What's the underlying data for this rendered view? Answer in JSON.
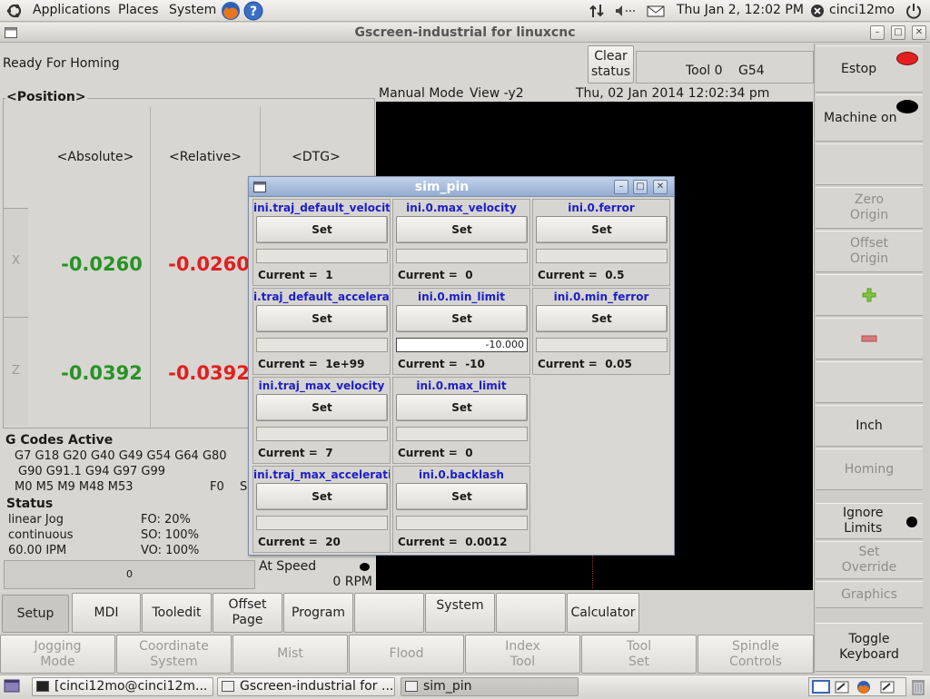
{
  "top_panel": {
    "menus": [
      "Applications",
      "Places",
      "System"
    ],
    "clock": "Thu Jan  2, 12:02 PM",
    "user": "cinci12mo"
  },
  "window": {
    "title": "Gscreen-industrial for linuxcnc"
  },
  "status_bar": {
    "message": "Ready For Homing",
    "clear_status": "Clear\nstatus",
    "tool": "Tool 0",
    "work_offset": "G54"
  },
  "position": {
    "header": "<Position>",
    "columns": [
      "<Absolute>",
      "<Relative>",
      "<DTG>"
    ],
    "axes": [
      {
        "label": "X",
        "absolute": "-0.0260",
        "relative": "-0.0260"
      },
      {
        "label": "Z",
        "absolute": "-0.0392",
        "relative": "-0.0392"
      }
    ]
  },
  "preview": {
    "mode": "Manual Mode",
    "view": "View -y2",
    "datetime": "Thu, 02 Jan 2014  12:02:34 pm"
  },
  "gcodes": {
    "header": "G Codes Active",
    "line1": "G7 G18 G20 G40 G49 G54 G64 G80",
    "line2": "G90 G91.1 G94 G97 G99",
    "line3": "M0 M5 M9 M48 M53",
    "feed": "F0",
    "spindle_partial": "S"
  },
  "status_panel": {
    "header": "Status",
    "jog": "linear Jog",
    "mode": "continuous",
    "rate": "60.00 IPM",
    "fo": "FO: 20%",
    "so": "SO: 100%",
    "vo": "VO: 100%",
    "jog_value": "0",
    "at_speed": "At Speed",
    "rpm": "0 RPM"
  },
  "right_buttons": {
    "estop": "Estop",
    "machine_on": "Machine on",
    "zero_origin": "Zero\nOrigin",
    "offset_origin": "Offset\nOrigin",
    "inch": "Inch",
    "homing": "Homing",
    "ignore_limits": "Ignore\nLimits",
    "set_override": "Set\nOverride",
    "graphics": "Graphics",
    "toggle_keyboard": "Toggle\nKeyboard"
  },
  "colors": {
    "estop_indicator": "#e32020",
    "absolute_value": "#279325",
    "relative_value": "#e02020",
    "pin_name": "#1c1ec8",
    "plus_green": "#7fc73a",
    "minus_red": "#d97a7a"
  },
  "main_tabs": [
    "Setup",
    "MDI",
    "Tooledit",
    "Offset\nPage",
    "Program",
    "System",
    "Calculator"
  ],
  "mode_buttons": [
    "Jogging\nMode",
    "Coordinate\nSystem",
    "Mist",
    "Flood",
    "Index\nTool",
    "Tool\nSet",
    "Spindle\nControls"
  ],
  "sim_pin": {
    "title": "sim_pin",
    "set_label": "Set",
    "current_prefix": "Current =",
    "pins": [
      {
        "name": "ini.traj_default_velocity",
        "current": "1",
        "input": ""
      },
      {
        "name": "ini.0.max_velocity",
        "current": "0",
        "input": ""
      },
      {
        "name": "ini.0.ferror",
        "current": "0.5",
        "input": ""
      },
      {
        "name": "i.traj_default_acceleratio",
        "current": "1e+99",
        "input": ""
      },
      {
        "name": "ini.0.min_limit",
        "current": "-10",
        "input": "-10.000"
      },
      {
        "name": "ini.0.min_ferror",
        "current": "0.05",
        "input": ""
      },
      {
        "name": "ini.traj_max_velocity",
        "current": "7",
        "input": ""
      },
      {
        "name": "ini.0.max_limit",
        "current": "0",
        "input": ""
      },
      {
        "name": "ini.traj_max_acceleration",
        "current": "20",
        "input": ""
      },
      {
        "name": "ini.0.backlash",
        "current": "0.0012",
        "input": ""
      }
    ]
  },
  "taskbar": {
    "tasks": [
      "[cinci12mo@cinci12m...",
      "Gscreen-industrial for ...",
      "sim_pin"
    ]
  }
}
